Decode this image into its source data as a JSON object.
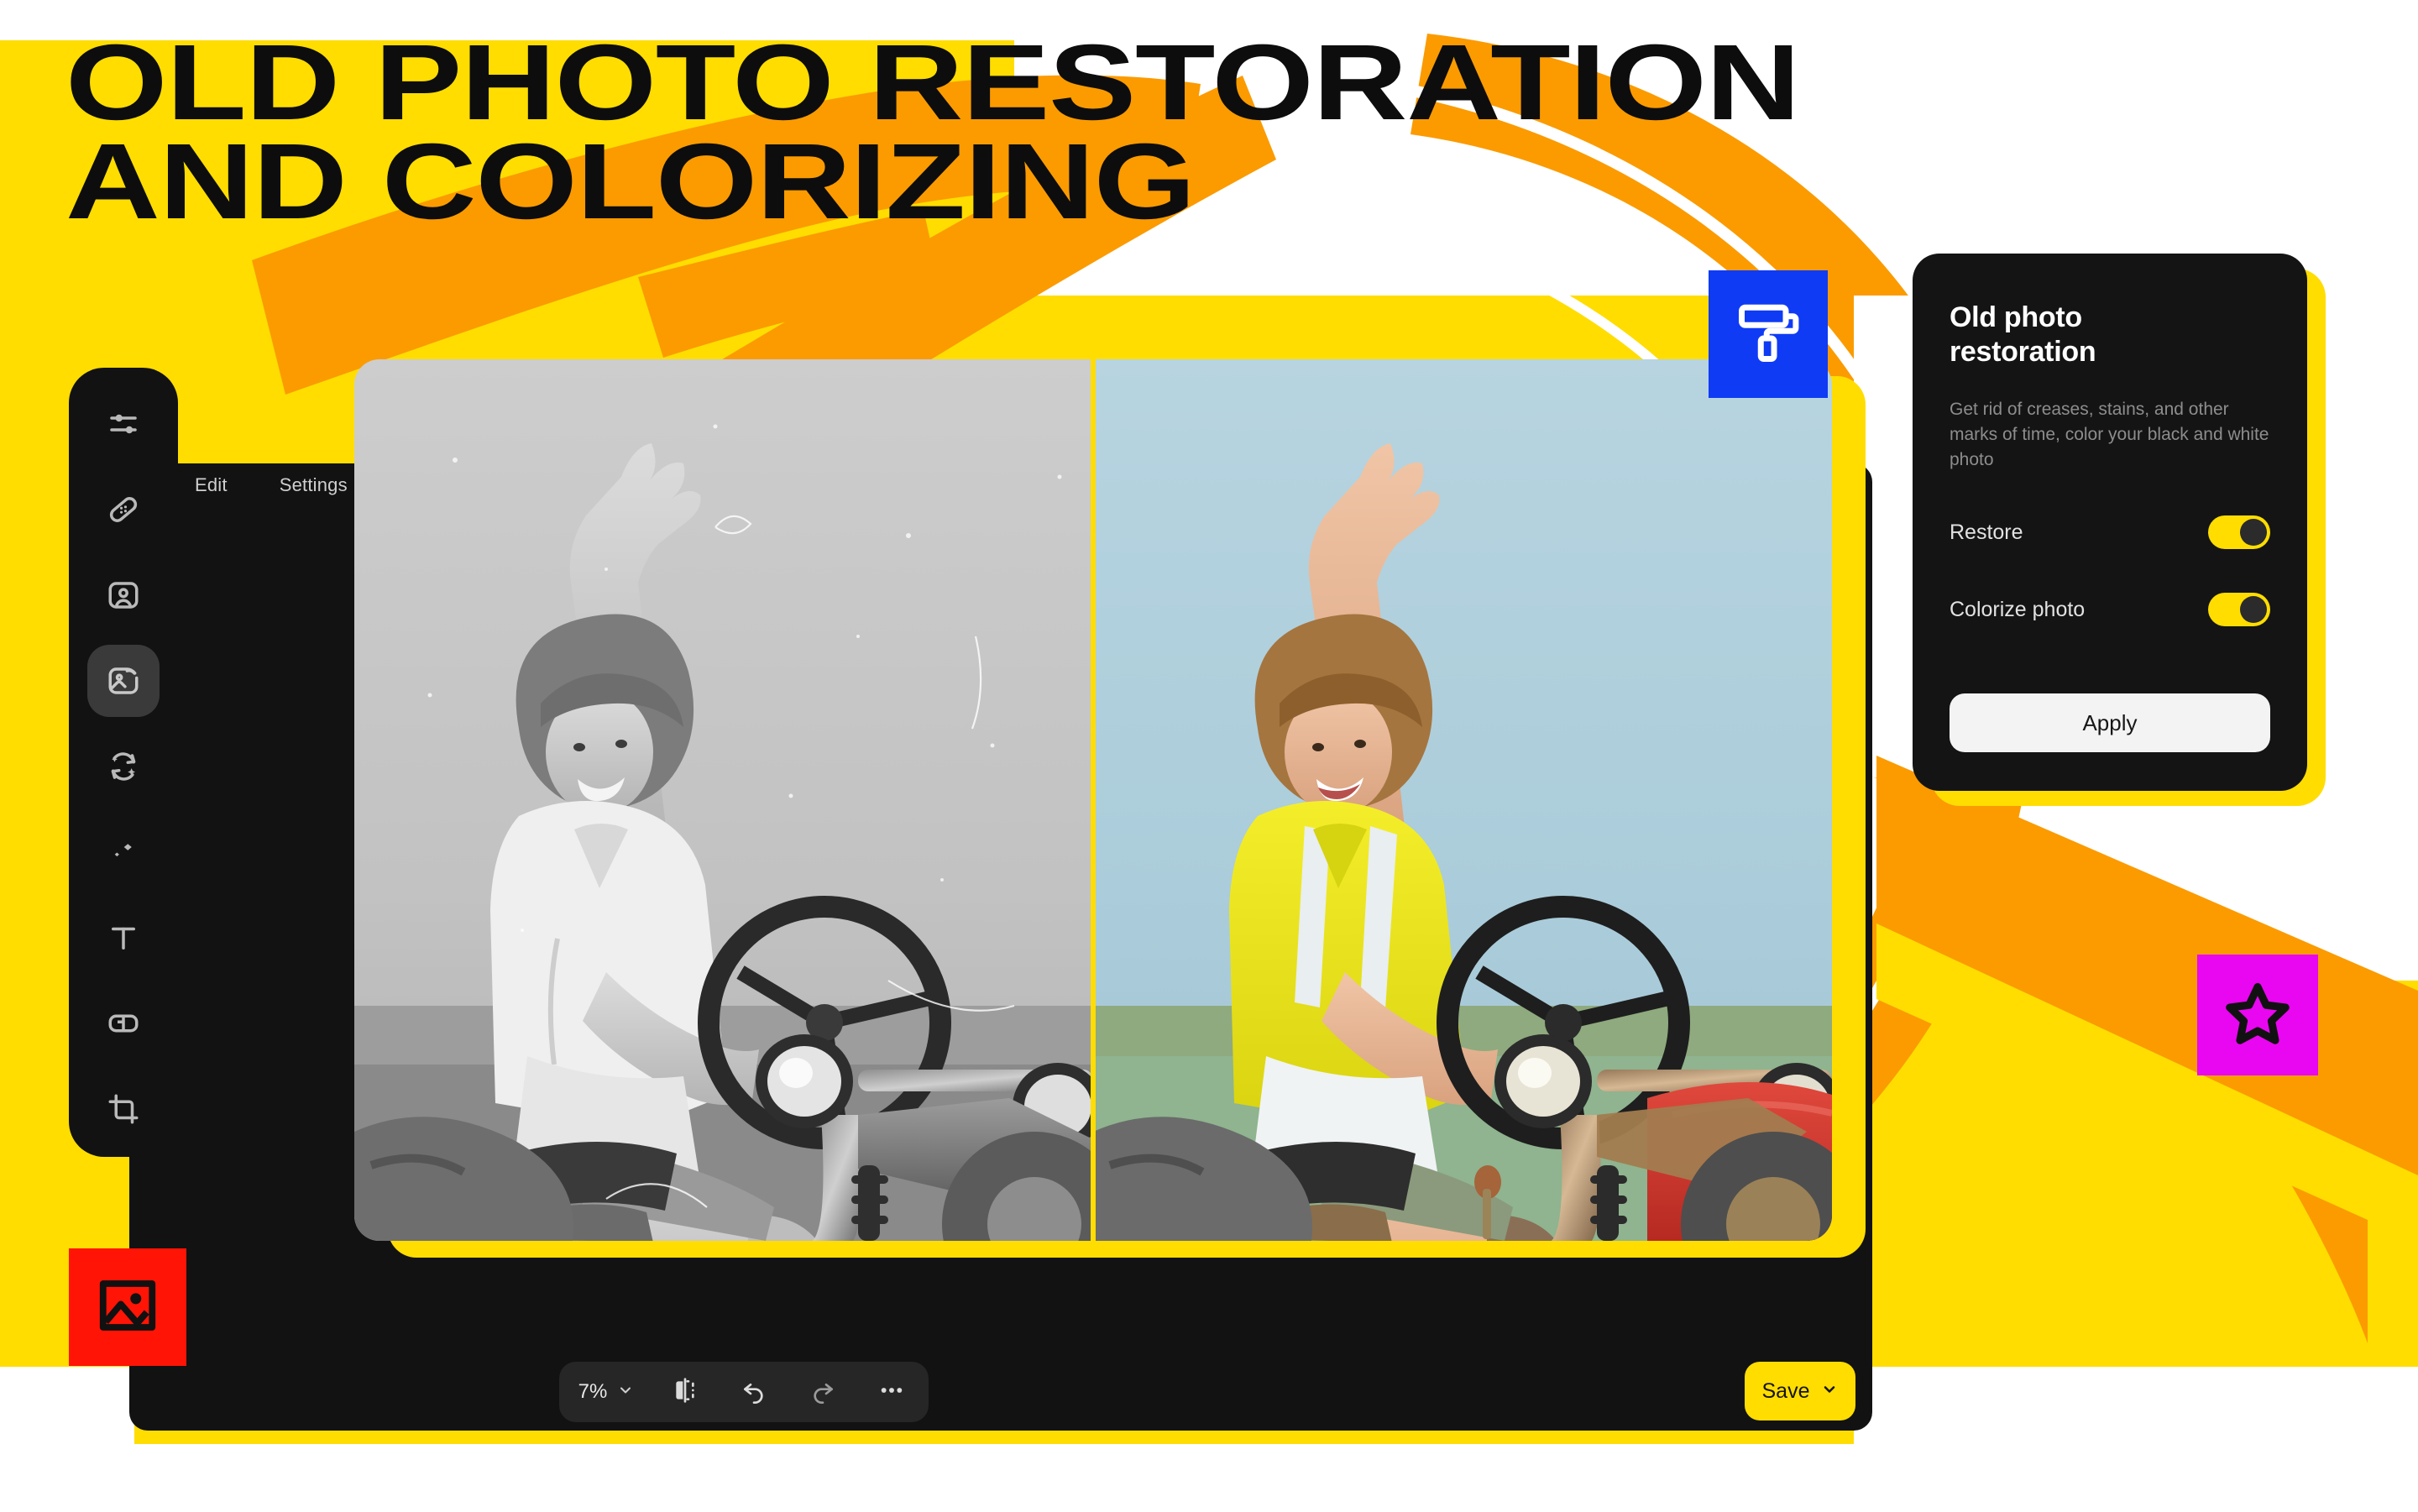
{
  "poster": {
    "headline": "OLD PHOTO RESTORATION\nAND COLORIZING",
    "colors": {
      "yellow": "#FFDD00",
      "orange": "#FB9B00",
      "panel_dark": "#121212",
      "card_dark": "#141414",
      "blue_badge": "#0F3BF5",
      "red_badge": "#FF1405",
      "magenta_badge": "#E906F0",
      "white": "#FFFFFF"
    }
  },
  "editor": {
    "tabs": [
      {
        "label": "Edit",
        "active": true
      },
      {
        "label": "Settings",
        "active": false
      }
    ],
    "toolbar": {
      "items": [
        {
          "icon": "adjustments-sliders-icon",
          "active": false
        },
        {
          "icon": "healing-bandage-icon",
          "active": false
        },
        {
          "icon": "portrait-retouch-icon",
          "active": false
        },
        {
          "icon": "image-restore-icon",
          "active": true
        },
        {
          "icon": "ai-refresh-icon",
          "active": false
        },
        {
          "icon": "magic-sparkle-icon",
          "active": false
        },
        {
          "icon": "text-tool-icon",
          "active": false
        },
        {
          "icon": "frame-shape-icon",
          "active": false
        },
        {
          "icon": "crop-tool-icon",
          "active": false
        }
      ]
    },
    "canvas": {
      "compare_mode": "before-after-split",
      "before_label": "black and white original",
      "after_label": "restored and colorized"
    },
    "bottom_bar": {
      "zoom_value": "7%",
      "zoom_chevron": "chevron-down-icon",
      "buttons": [
        {
          "icon": "compare-split-icon",
          "name": "compare-button"
        },
        {
          "icon": "undo-icon",
          "name": "undo-button"
        },
        {
          "icon": "redo-icon",
          "name": "redo-button"
        },
        {
          "icon": "more-ellipsis-icon",
          "name": "more-options-button"
        }
      ]
    },
    "save": {
      "label": "Save",
      "chevron": "chevron-down-icon"
    }
  },
  "settings_panel": {
    "title": "Old photo\nrestoration",
    "description": "Get rid of creases, stains, and other marks of time, color your black and white photo",
    "toggles": [
      {
        "label": "Restore",
        "on": true
      },
      {
        "label": "Colorize photo",
        "on": true
      }
    ],
    "apply_label": "Apply"
  },
  "badges": [
    {
      "name": "paint-roller-badge",
      "icon": "paint-roller-icon",
      "color": "#0F3BF5"
    },
    {
      "name": "image-badge",
      "icon": "image-icon",
      "color": "#FF1405"
    },
    {
      "name": "star-badge",
      "icon": "star-icon",
      "color": "#E906F0"
    }
  ]
}
